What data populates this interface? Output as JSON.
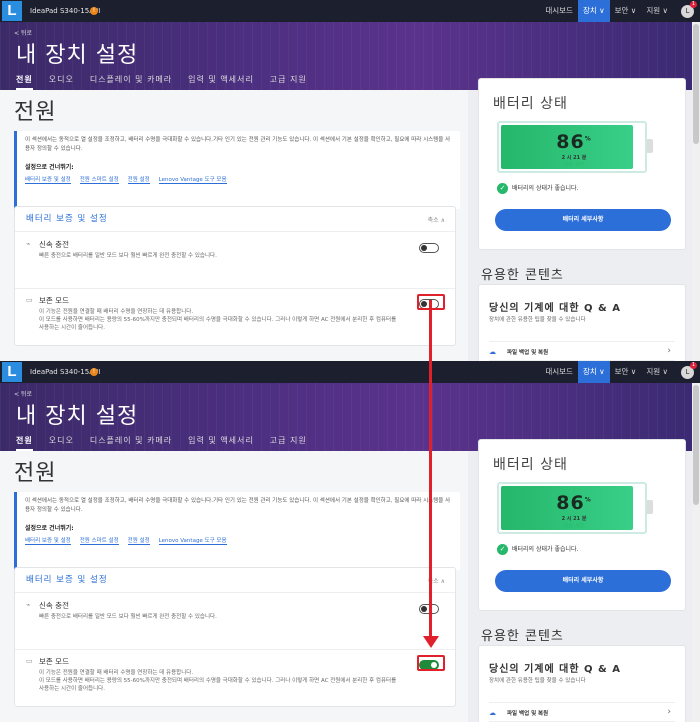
{
  "topbar": {
    "logo": "L",
    "device": "IdeaPad S340-15API",
    "warn": "!",
    "nav": [
      "대시보드",
      "장치 ∨",
      "보안 ∨",
      "지원 ∨"
    ],
    "user_initial": "L",
    "notify": "1"
  },
  "hero": {
    "back": "< 뒤로",
    "title": "내 장치 설정",
    "tabs": [
      "전원",
      "오디오",
      "디스플레이 및 카메라",
      "입력 및 액세서리",
      "고급 지원"
    ]
  },
  "section": {
    "title": "전원",
    "intro": "이 섹션에서는 동적으로 열 설정을 조정하고, 배터리 수명을 극대화할 수 있습니다.기타 인기 있는 전원 관리 기능도 있습니다. 이 섹션에서 기본 설정을 확인하고, 필요에 따라 시스템을 사용자 정의할 수 있습니다.",
    "skip_label": "설정으로 건너뛰기:",
    "links": [
      "배터리 보증 및 설정",
      "전원 스마트 설정",
      "전원 설정",
      "Lenovo Vantage 도구 모음"
    ]
  },
  "card": {
    "title": "배터리 보증 및 설정",
    "collapse": "축소 ∧",
    "fast_charge": {
      "name": "신속 충전",
      "desc": "빠른 충전으로 배터리를 일반 모드 보다 훨씬 빠르게 완전 충전할 수 있습니다."
    },
    "conservation": {
      "name": "보존 모드",
      "desc1": "이 기능은 전원을 연결할 때 배터리 수명을 연장하는 데 유용합니다.",
      "desc2": "이 모드를 사용하면 배터리는 용량의 55-60%까지만 충전되며 배터리의 수명을 극대화할 수 있습니다. 그러나 이렇게 하면 AC 전원에서 분리한 후 컴퓨터를 사용하는 시간이 줄어듭니다."
    }
  },
  "battery": {
    "title": "배터리 상태",
    "percent": "86",
    "pct_sign": "%",
    "time": "2 시 21 분",
    "left": "남은 시간",
    "health": "배터리의 상태가 좋습니다.",
    "details": "배터리 세부사항"
  },
  "useful": {
    "title": "유용한 콘텐츠",
    "q_title": "당신의 기계에 대한 Q & A",
    "q_sub": "장치에 관한 유용한 팁을 찾을 수 있습니다",
    "row": "파일 백업 및 복원"
  },
  "states": {
    "before": "off",
    "after": "on"
  },
  "colors": {
    "accent": "#2d6fd8",
    "highlight": "#e0202a",
    "on": "#1f8a3a"
  }
}
